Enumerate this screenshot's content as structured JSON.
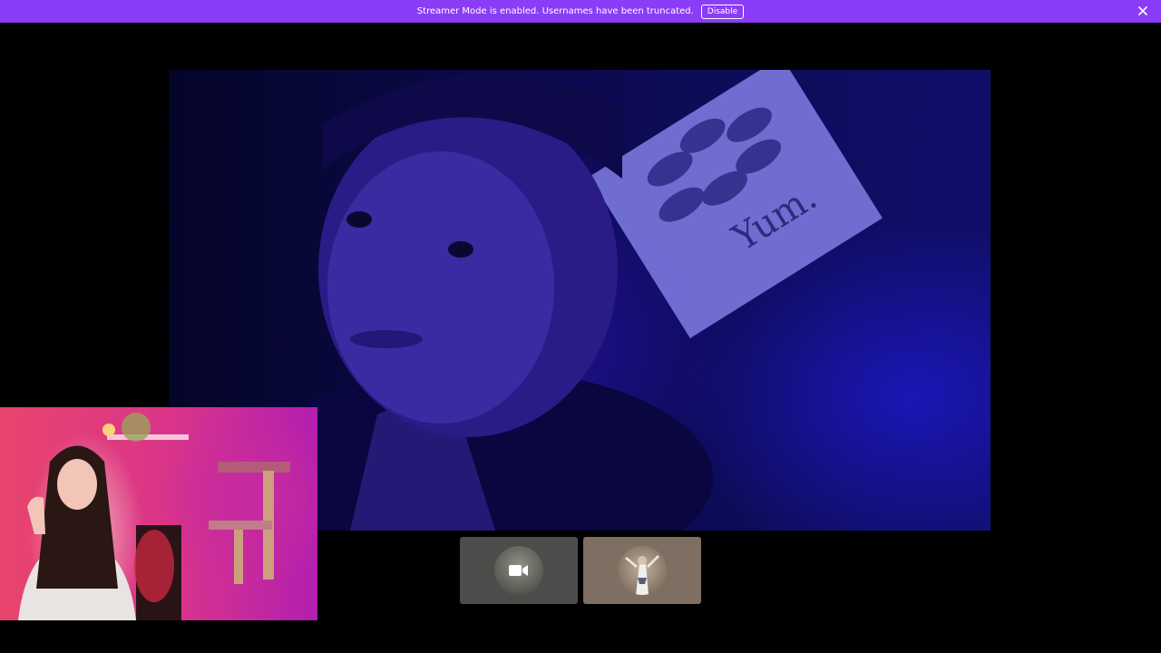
{
  "banner": {
    "message": "Streamer Mode is enabled. Usernames have been truncated.",
    "disable_label": "Disable",
    "background_color": "#8a3cf6",
    "close_icon": "close-icon"
  },
  "main_video": {
    "poster_text": "Yum."
  },
  "participants": [
    {
      "icon": "video-camera-icon",
      "state": "camera-on"
    },
    {
      "icon": "avatar-image"
    }
  ]
}
